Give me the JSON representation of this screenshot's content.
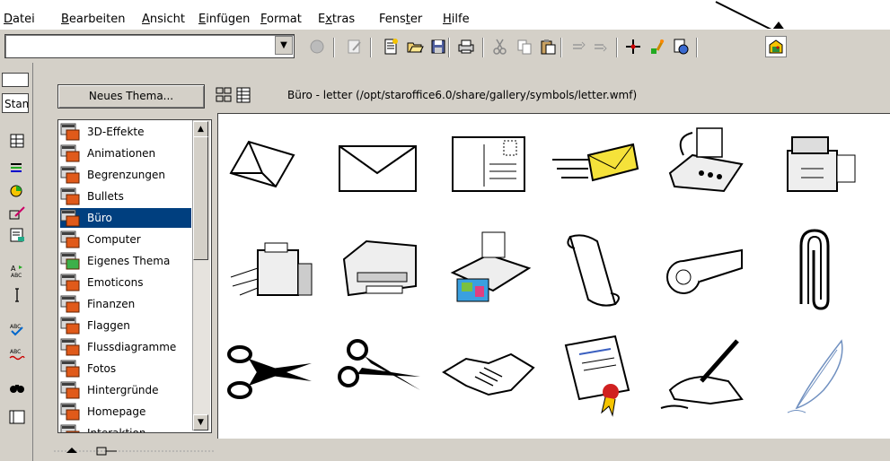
{
  "menu": {
    "items": [
      {
        "acc": "D",
        "rest": "atei"
      },
      {
        "acc": "B",
        "rest": "earbeiten"
      },
      {
        "acc": "A",
        "rest": "nsicht"
      },
      {
        "acc": "E",
        "rest": "infügen"
      },
      {
        "acc": "F",
        "rest": "ormat"
      },
      {
        "pre": "E",
        "acc": "x",
        "rest": "tras"
      },
      {
        "pre": "Fens",
        "acc": "t",
        "rest": "er"
      },
      {
        "acc": "H",
        "rest": "ilfe"
      }
    ]
  },
  "toolbar": {
    "url_value": "",
    "icons": [
      "stop-icon",
      "edit-icon",
      "new-doc-icon",
      "open-icon",
      "save-icon",
      "print-icon",
      "cut-icon",
      "copy-icon",
      "paste-icon",
      "undo-icon",
      "redo-icon",
      "navigator-icon",
      "stylist-icon",
      "data-sources-icon",
      "gallery-icon"
    ]
  },
  "sidebar": {
    "style_box": "Stan"
  },
  "gallery": {
    "new_theme_label": "Neues Thema...",
    "path": "Büro - letter (/opt/staroffice6.0/share/gallery/symbols/letter.wmf)",
    "themes": [
      "3D-Effekte",
      "Animationen",
      "Begrenzungen",
      "Bullets",
      "Büro",
      "Computer",
      "Eigenes Thema",
      "Emoticons",
      "Finanzen",
      "Flaggen",
      "Flussdiagramme",
      "Fotos",
      "Hintergründe",
      "Homepage",
      "Interaktion"
    ],
    "selected": "Büro",
    "clips": [
      "folded-letter",
      "envelope",
      "postcard",
      "flying-letter",
      "fax-machine",
      "copier",
      "shredder",
      "laser-printer",
      "inkjet-printer",
      "scroll-paper",
      "rolled-paper",
      "paper-clip",
      "scissors-large",
      "scissors-small",
      "handshake",
      "certificate",
      "writing-hand",
      "quill-feather"
    ]
  }
}
